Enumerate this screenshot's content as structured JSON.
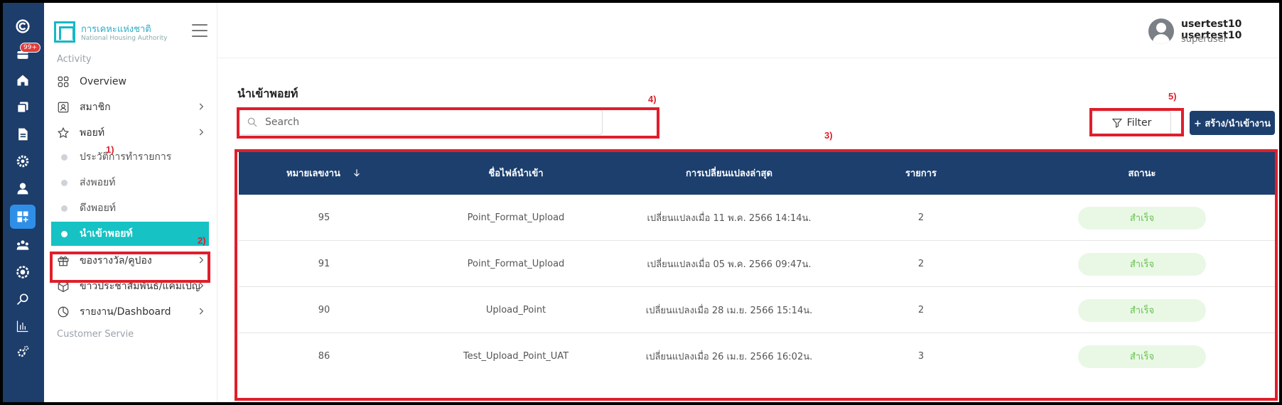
{
  "rail": {
    "badge": "99+",
    "icons": [
      "c-logo-icon",
      "inbox-icon",
      "home-icon",
      "copy-icon",
      "document-icon",
      "settings-icon",
      "user-icon",
      "dashboard-icon",
      "group-icon",
      "badge-icon",
      "search-icon",
      "bar-chart-icon",
      "gear-icon"
    ]
  },
  "sidebar": {
    "logo_title": "การเคหะแห่งชาติ",
    "logo_subtitle": "National Housing Authority",
    "section_activity": "Activity",
    "section_customer": "Customer Servie",
    "items": [
      {
        "label": "Overview"
      },
      {
        "label": "สมาชิก"
      },
      {
        "label": "พอยท์"
      },
      {
        "label": "ของรางวัล/คูปอง"
      },
      {
        "label": "ข่าวประชาสัมพันธ์/แคมเปญ"
      },
      {
        "label": "รายงาน/Dashboard"
      }
    ],
    "sub_items": [
      {
        "label": "ประวัติการทำรายการ"
      },
      {
        "label": "ส่งพอยท์"
      },
      {
        "label": "ดึงพอยท์"
      },
      {
        "label": "นำเข้าพอยท์"
      }
    ]
  },
  "header": {
    "user_name": "usertest10 usertest10",
    "user_role": "superuser"
  },
  "main": {
    "title": "นำเข้าพอยท์",
    "search_placeholder": "Search",
    "filter_label": "Filter",
    "create_label": "+ สร้าง/นำเข้างาน",
    "columns": [
      "หมายเลขงาน",
      "ชื่อไฟล์นำเข้า",
      "การเปลี่ยนแปลงล่าสุด",
      "รายการ",
      "สถานะ"
    ],
    "rows": [
      {
        "id": "95",
        "file": "Point_Format_Upload",
        "changed": "เปลี่ยนแปลงเมื่อ 11 พ.ค. 2566 14:14น.",
        "count": "2",
        "status": "สำเร็จ"
      },
      {
        "id": "91",
        "file": "Point_Format_Upload",
        "changed": "เปลี่ยนแปลงเมื่อ 05 พ.ค. 2566 09:47น.",
        "count": "2",
        "status": "สำเร็จ"
      },
      {
        "id": "90",
        "file": "Upload_Point",
        "changed": "เปลี่ยนแปลงเมื่อ 28 เม.ย. 2566 15:14น.",
        "count": "2",
        "status": "สำเร็จ"
      },
      {
        "id": "86",
        "file": "Test_Upload_Point_UAT",
        "changed": "เปลี่ยนแปลงเมื่อ 26 เม.ย. 2566 16:02น.",
        "count": "3",
        "status": "สำเร็จ"
      }
    ]
  },
  "annotations": {
    "a1": "1)",
    "a2": "2)",
    "a3": "3)",
    "a4": "4)",
    "a5": "5)",
    "color": "#e01e2b"
  },
  "colors": {
    "rail": "#1d3d6b",
    "header_row": "#1c3f6e",
    "active_menu": "#16c2c4",
    "status_bg": "#e9f8e5",
    "status_text": "#67c14f"
  }
}
